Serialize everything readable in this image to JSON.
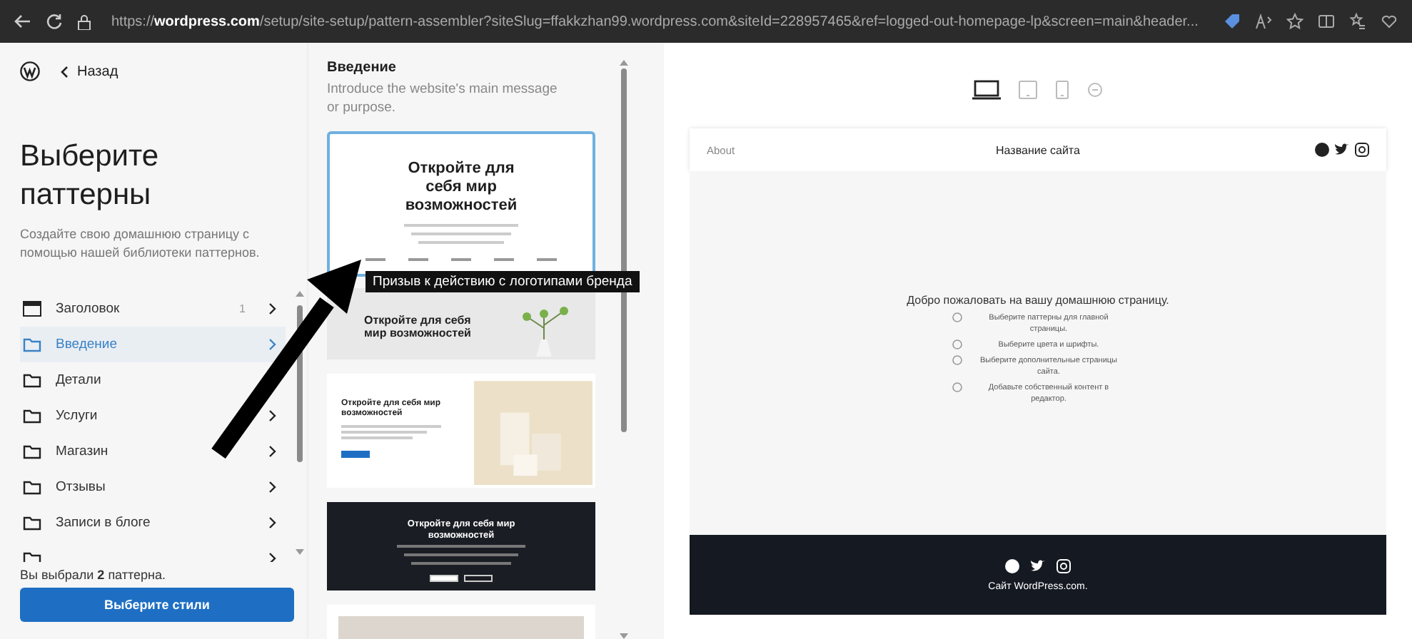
{
  "browser": {
    "url": "https://**wordpress.com**/setup/site-setup/pattern-assembler?siteSlug=ffakkzhan99.wordpress.com&siteId=228957465&ref=logged-out-homepage-lp&screen=main&header..."
  },
  "sidebar": {
    "back": "Назад",
    "title": "Выберите паттерны",
    "description": "Создайте свою домашнюю страницу с помощью нашей библиотеки паттернов.",
    "items": [
      {
        "kind": "header",
        "label": "Заголовок",
        "count": "1",
        "selected": false
      },
      {
        "kind": "folder",
        "label": "Введение",
        "selected": true
      },
      {
        "kind": "folder",
        "label": "Детали",
        "selected": false
      },
      {
        "kind": "folder",
        "label": "Услуги",
        "selected": false
      },
      {
        "kind": "folder",
        "label": "Магазин",
        "selected": false
      },
      {
        "kind": "folder",
        "label": "Отзывы",
        "selected": false
      },
      {
        "kind": "folder",
        "label": "Записи в блоге",
        "selected": false
      },
      {
        "kind": "cut",
        "selected": false
      }
    ],
    "summary": "Вы выбрали **2** паттерна.",
    "button": "Выберите стили"
  },
  "patterns": {
    "title": "Введение",
    "description": "Introduce the website's main message or purpose.",
    "cards": [
      {
        "kind": "centered",
        "title": "Откройте для себя мир возможностей",
        "selected": true,
        "tooltip": "Призыв к действию с логотипами бренда"
      },
      {
        "kind": "banner",
        "title": "Откройте для себя мир возможностей",
        "selected": false
      },
      {
        "kind": "split",
        "title": "Откройте для себя мир возможностей",
        "selected": false
      },
      {
        "kind": "dark",
        "title": "Откройте для себя мир возможностей",
        "selected": false
      },
      {
        "kind": "photo",
        "selected": false
      }
    ]
  },
  "preview": {
    "devices": [
      {
        "kind": "desktop",
        "selected": true
      },
      {
        "kind": "tablet",
        "selected": false
      },
      {
        "kind": "phone",
        "selected": false
      },
      {
        "kind": "zoom",
        "selected": false
      }
    ],
    "nav_link": "About",
    "site_title": "Название сайта",
    "welcome": "Добро пожаловать на вашу домашнюю страницу.",
    "steps": [
      "Выберите паттерны для главной страницы.",
      "Выберите цвета и шрифты.",
      "Выберите дополнительные страницы сайта.",
      "Добавьте собственный контент в редактор."
    ],
    "footer": "Сайт WordPress.com."
  }
}
